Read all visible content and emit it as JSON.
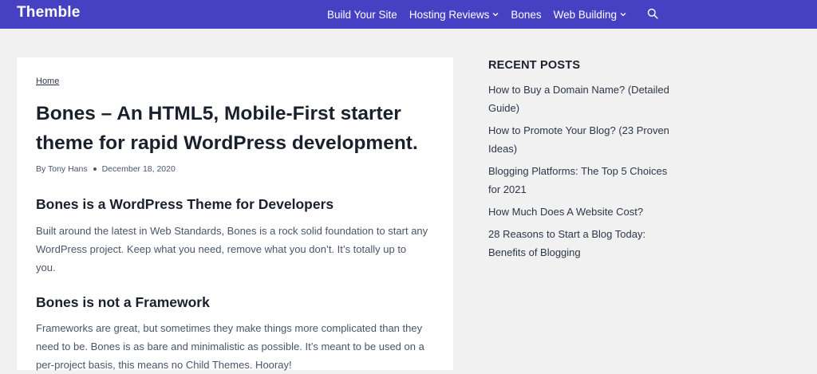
{
  "header": {
    "brand": "Themble",
    "nav": [
      {
        "label": "Build Your Site",
        "has_dropdown": false
      },
      {
        "label": "Hosting Reviews",
        "has_dropdown": true
      },
      {
        "label": "Bones",
        "has_dropdown": false
      },
      {
        "label": "Web Building",
        "has_dropdown": true
      }
    ],
    "search_icon": "search-icon",
    "bg_color": "#4640c2"
  },
  "article": {
    "breadcrumb": "Home",
    "title": "Bones – An HTML5, Mobile-First starter theme for rapid WordPress development.",
    "author": "By Tony Hans",
    "date": "December 18, 2020",
    "sections": [
      {
        "heading": "Bones is a WordPress Theme for Developers",
        "text": "Built around the latest in Web Standards, Bones is a rock solid foundation to start any WordPress project. Keep what you need, remove what you don’t. It’s totally up to you."
      },
      {
        "heading": "Bones is not a Framework",
        "text": "Frameworks are great, but sometimes they make things more complicated than they need to be. Bones is as bare and minimalistic as possible. It’s meant to be used on a per-project basis, this means no Child Themes. Hooray!"
      }
    ]
  },
  "sidebar": {
    "title": "RECENT POSTS",
    "posts": [
      "How to Buy a Domain Name? (Detailed Guide)",
      "How to Promote Your Blog? (23 Proven Ideas)",
      "Blogging Platforms: The Top 5 Choices for 2021",
      "How Much Does A Website Cost?",
      "28 Reasons to Start a Blog Today: Benefits of Blogging"
    ]
  }
}
